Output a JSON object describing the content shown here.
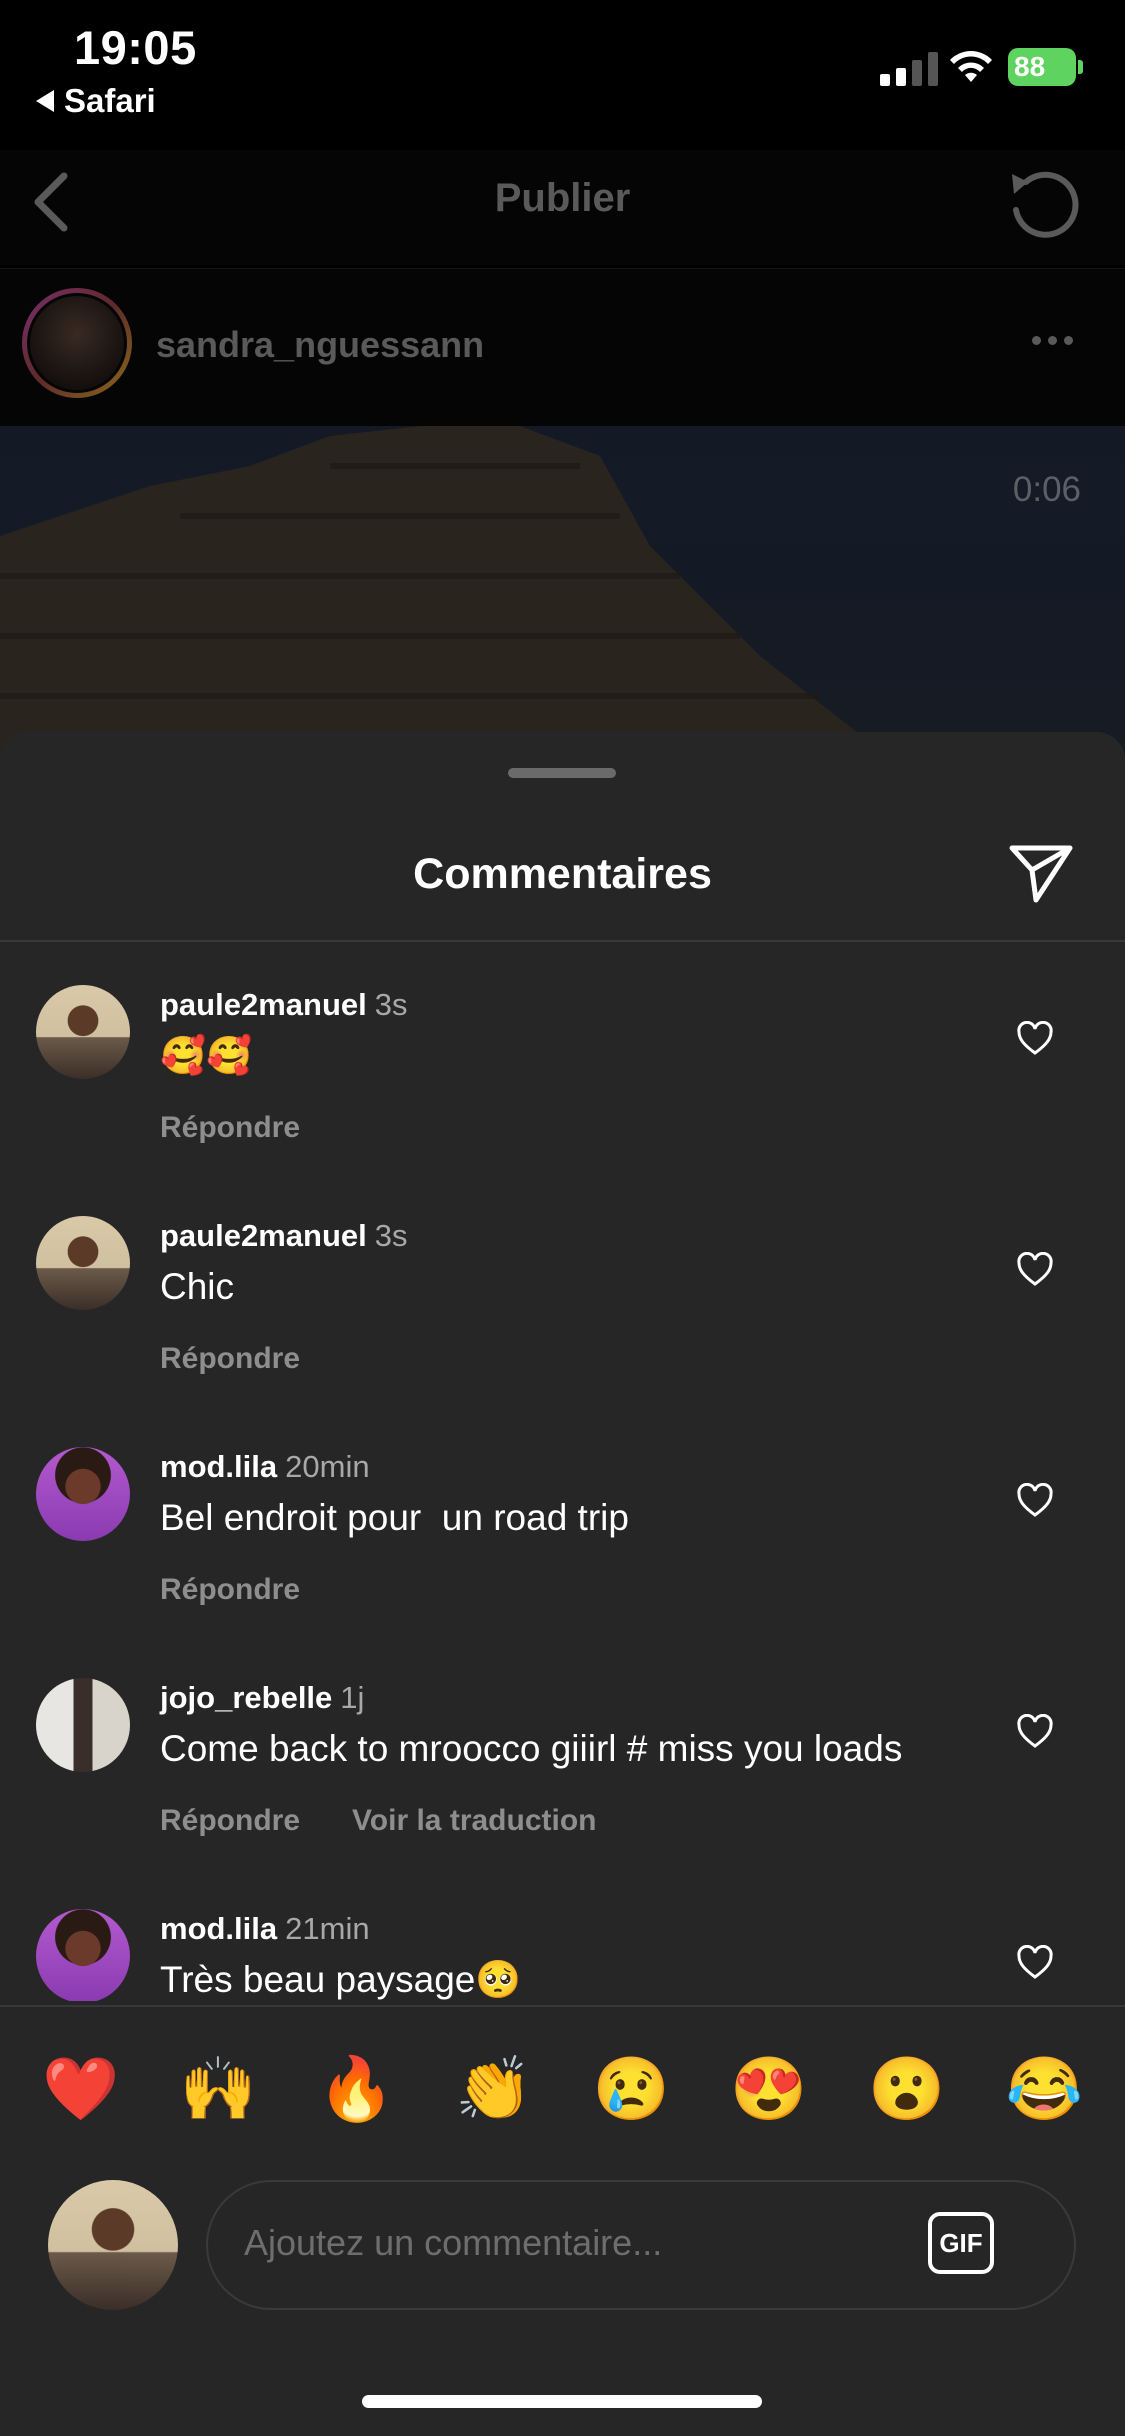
{
  "status_bar": {
    "time": "19:05",
    "back_app": "Safari",
    "battery": "88"
  },
  "nav": {
    "title": "Publier"
  },
  "post": {
    "username": "sandra_nguessann",
    "video_time": "0:06"
  },
  "sheet": {
    "title": "Commentaires"
  },
  "comments": [
    {
      "username": "paule2manuel",
      "time": "3s",
      "text": "🥰🥰",
      "reply": "Répondre",
      "translate": ""
    },
    {
      "username": "paule2manuel",
      "time": "3s",
      "text": "Chic",
      "reply": "Répondre",
      "translate": ""
    },
    {
      "username": "mod.lila",
      "time": "20min",
      "text": "Bel endroit pour  un road trip",
      "reply": "Répondre",
      "translate": ""
    },
    {
      "username": "jojo_rebelle",
      "time": "1j",
      "text": "Come back to mroocco giiirl # miss you loads",
      "reply": "Répondre",
      "translate": "Voir la traduction"
    },
    {
      "username": "mod.lila",
      "time": "21min",
      "text": "Très beau paysage🥺",
      "reply": "",
      "translate": ""
    }
  ],
  "emoji_reactions": [
    "❤️",
    "🙌",
    "🔥",
    "👏",
    "😢",
    "😍",
    "😮",
    "😂"
  ],
  "composer": {
    "placeholder": "Ajoutez un commentaire...",
    "gif_label": "GIF"
  },
  "colors": {
    "sheet_bg": "#262626",
    "battery": "#5fd35f",
    "muted_text": "#8e8e8e"
  }
}
